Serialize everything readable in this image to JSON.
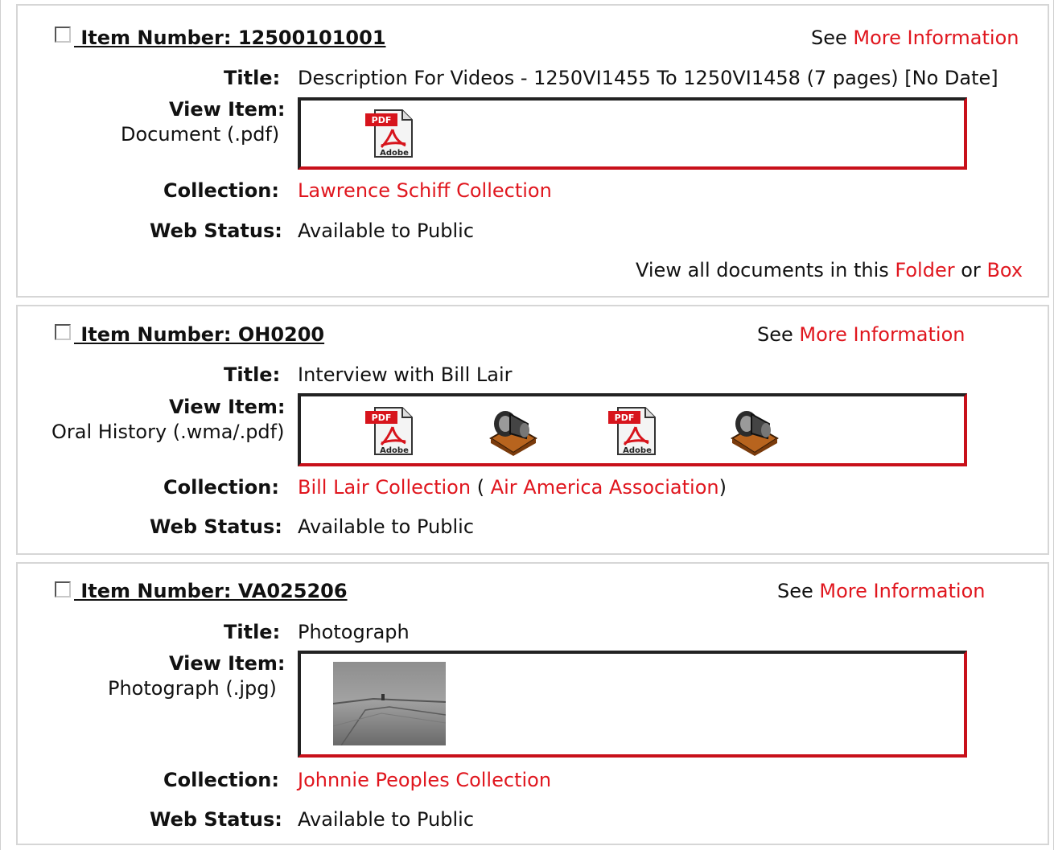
{
  "items": [
    {
      "item_number": " Item Number: 12500101001",
      "see": "See",
      "more_info": "More Information",
      "title_label": "Title:",
      "title": "Description For Videos - 1250VI1455 To 1250VI1458 (7 pages) [No Date]",
      "view_label": "View Item:",
      "view_type": "Document (.pdf)",
      "collection_label": "Collection:",
      "collection": "Lawrence Schiff Collection",
      "status_label": "Web Status:",
      "status": "Available to Public",
      "view_all_prefix": "View all documents in this",
      "folder": "Folder",
      "or": "or",
      "box": "Box",
      "icons": [
        "pdf-icon"
      ]
    },
    {
      "item_number": " Item Number: OH0200",
      "see": "See",
      "more_info": "More Information",
      "title_label": "Title:",
      "title": "Interview with Bill Lair",
      "view_label": "View Item:",
      "view_type": "Oral History (.wma/.pdf)",
      "collection_label": "Collection:",
      "collection": "Bill Lair Collection",
      "paren_open": "(",
      "collection2": "Air America Association",
      "paren_close": ")",
      "status_label": "Web Status:",
      "status": "Available to Public",
      "icons": [
        "pdf-icon",
        "speaker-icon",
        "pdf-icon",
        "speaker-icon"
      ]
    },
    {
      "item_number": " Item Number: VA025206",
      "see": "See",
      "more_info": "More Information",
      "title_label": "Title:",
      "title": "Photograph",
      "view_label": "View Item:",
      "view_type": "Photograph (.jpg)",
      "collection_label": "Collection:",
      "collection": "Johnnie Peoples Collection",
      "status_label": "Web Status:",
      "status": "Available to Public",
      "icons": [
        "photo-thumbnail"
      ]
    }
  ],
  "pdf_badge": "PDF",
  "pdf_brand": "Adobe",
  "colors": {
    "link": "#e0161e",
    "box_border": "#c8101a"
  }
}
